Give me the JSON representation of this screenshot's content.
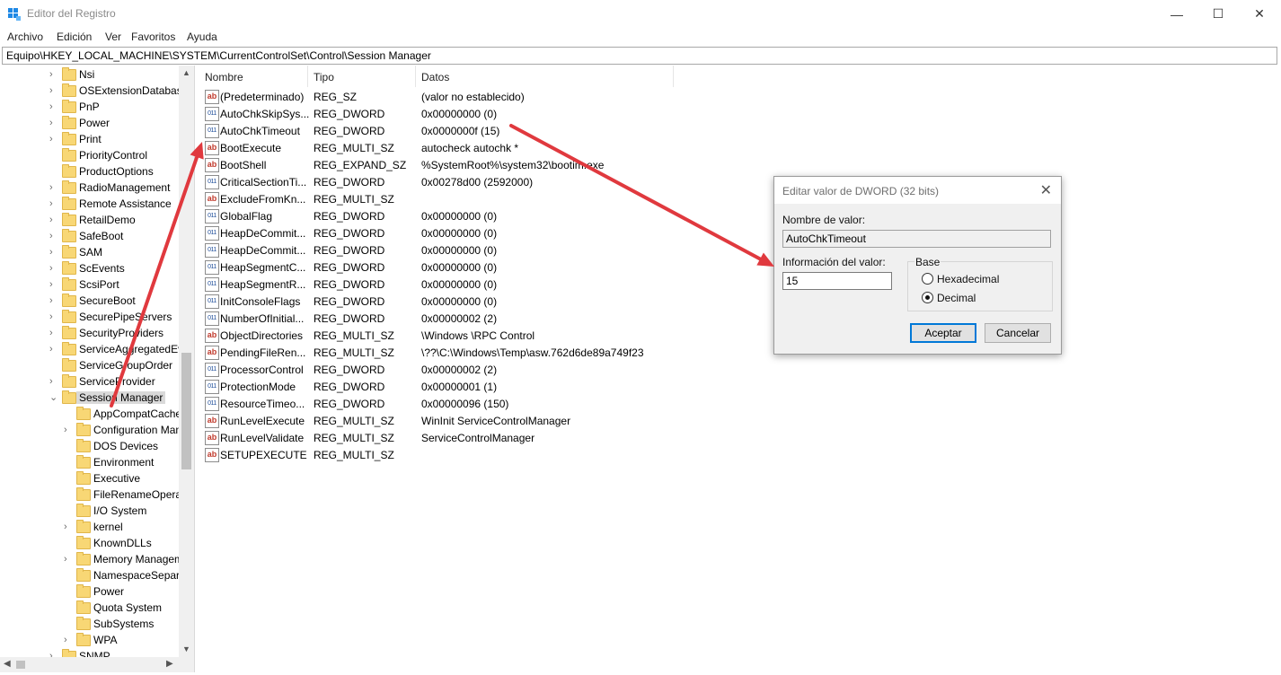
{
  "window": {
    "title": "Editor del Registro",
    "controls": {
      "minimize": "—",
      "maximize": "☐",
      "close": "✕"
    }
  },
  "menu": [
    "Archivo",
    "Edición",
    "Ver",
    "Favoritos",
    "Ayuda"
  ],
  "address": "Equipo\\HKEY_LOCAL_MACHINE\\SYSTEM\\CurrentControlSet\\Control\\Session Manager",
  "tree": {
    "items": [
      {
        "label": "Nsi",
        "level": 1,
        "expand": "collapsed"
      },
      {
        "label": "OSExtensionDatabase",
        "level": 1,
        "expand": "collapsed"
      },
      {
        "label": "PnP",
        "level": 1,
        "expand": "collapsed"
      },
      {
        "label": "Power",
        "level": 1,
        "expand": "collapsed"
      },
      {
        "label": "Print",
        "level": 1,
        "expand": "collapsed"
      },
      {
        "label": "PriorityControl",
        "level": 1,
        "expand": "none"
      },
      {
        "label": "ProductOptions",
        "level": 1,
        "expand": "none"
      },
      {
        "label": "RadioManagement",
        "level": 1,
        "expand": "collapsed"
      },
      {
        "label": "Remote Assistance",
        "level": 1,
        "expand": "collapsed"
      },
      {
        "label": "RetailDemo",
        "level": 1,
        "expand": "collapsed"
      },
      {
        "label": "SafeBoot",
        "level": 1,
        "expand": "collapsed"
      },
      {
        "label": "SAM",
        "level": 1,
        "expand": "collapsed"
      },
      {
        "label": "ScEvents",
        "level": 1,
        "expand": "collapsed"
      },
      {
        "label": "ScsiPort",
        "level": 1,
        "expand": "collapsed"
      },
      {
        "label": "SecureBoot",
        "level": 1,
        "expand": "collapsed"
      },
      {
        "label": "SecurePipeServers",
        "level": 1,
        "expand": "collapsed"
      },
      {
        "label": "SecurityProviders",
        "level": 1,
        "expand": "collapsed"
      },
      {
        "label": "ServiceAggregatedEvents",
        "level": 1,
        "expand": "collapsed"
      },
      {
        "label": "ServiceGroupOrder",
        "level": 1,
        "expand": "none"
      },
      {
        "label": "ServiceProvider",
        "level": 1,
        "expand": "collapsed"
      },
      {
        "label": "Session Manager",
        "level": 1,
        "expand": "expanded",
        "selected": true
      },
      {
        "label": "AppCompatCache",
        "level": 2,
        "expand": "none"
      },
      {
        "label": "Configuration Manager",
        "level": 2,
        "expand": "collapsed"
      },
      {
        "label": "DOS Devices",
        "level": 2,
        "expand": "none"
      },
      {
        "label": "Environment",
        "level": 2,
        "expand": "none"
      },
      {
        "label": "Executive",
        "level": 2,
        "expand": "none"
      },
      {
        "label": "FileRenameOperations",
        "level": 2,
        "expand": "none"
      },
      {
        "label": "I/O System",
        "level": 2,
        "expand": "none"
      },
      {
        "label": "kernel",
        "level": 2,
        "expand": "collapsed"
      },
      {
        "label": "KnownDLLs",
        "level": 2,
        "expand": "none"
      },
      {
        "label": "Memory Management",
        "level": 2,
        "expand": "collapsed"
      },
      {
        "label": "NamespaceSeparation",
        "level": 2,
        "expand": "none"
      },
      {
        "label": "Power",
        "level": 2,
        "expand": "none"
      },
      {
        "label": "Quota System",
        "level": 2,
        "expand": "none"
      },
      {
        "label": "SubSystems",
        "level": 2,
        "expand": "none"
      },
      {
        "label": "WPA",
        "level": 2,
        "expand": "collapsed"
      },
      {
        "label": "SNMP",
        "level": 1,
        "expand": "collapsed"
      }
    ]
  },
  "list": {
    "columns": [
      "Nombre",
      "Tipo",
      "Datos"
    ],
    "rows": [
      {
        "icon": "sz",
        "name": "(Predeterminado)",
        "type": "REG_SZ",
        "data": "(valor no establecido)"
      },
      {
        "icon": "bin",
        "name": "AutoChkSkipSys...",
        "type": "REG_DWORD",
        "data": "0x00000000 (0)"
      },
      {
        "icon": "bin",
        "name": "AutoChkTimeout",
        "type": "REG_DWORD",
        "data": "0x0000000f (15)"
      },
      {
        "icon": "sz",
        "name": "BootExecute",
        "type": "REG_MULTI_SZ",
        "data": "autocheck autochk *"
      },
      {
        "icon": "sz",
        "name": "BootShell",
        "type": "REG_EXPAND_SZ",
        "data": "%SystemRoot%\\system32\\bootim.exe"
      },
      {
        "icon": "bin",
        "name": "CriticalSectionTi...",
        "type": "REG_DWORD",
        "data": "0x00278d00 (2592000)"
      },
      {
        "icon": "sz",
        "name": "ExcludeFromKn...",
        "type": "REG_MULTI_SZ",
        "data": ""
      },
      {
        "icon": "bin",
        "name": "GlobalFlag",
        "type": "REG_DWORD",
        "data": "0x00000000 (0)"
      },
      {
        "icon": "bin",
        "name": "HeapDeCommit...",
        "type": "REG_DWORD",
        "data": "0x00000000 (0)"
      },
      {
        "icon": "bin",
        "name": "HeapDeCommit...",
        "type": "REG_DWORD",
        "data": "0x00000000 (0)"
      },
      {
        "icon": "bin",
        "name": "HeapSegmentC...",
        "type": "REG_DWORD",
        "data": "0x00000000 (0)"
      },
      {
        "icon": "bin",
        "name": "HeapSegmentR...",
        "type": "REG_DWORD",
        "data": "0x00000000 (0)"
      },
      {
        "icon": "bin",
        "name": "InitConsoleFlags",
        "type": "REG_DWORD",
        "data": "0x00000000 (0)"
      },
      {
        "icon": "bin",
        "name": "NumberOfInitial...",
        "type": "REG_DWORD",
        "data": "0x00000002 (2)"
      },
      {
        "icon": "sz",
        "name": "ObjectDirectories",
        "type": "REG_MULTI_SZ",
        "data": "\\Windows \\RPC Control"
      },
      {
        "icon": "sz",
        "name": "PendingFileRen...",
        "type": "REG_MULTI_SZ",
        "data": "\\??\\C:\\Windows\\Temp\\asw.762d6de89a749f23"
      },
      {
        "icon": "bin",
        "name": "ProcessorControl",
        "type": "REG_DWORD",
        "data": "0x00000002 (2)"
      },
      {
        "icon": "bin",
        "name": "ProtectionMode",
        "type": "REG_DWORD",
        "data": "0x00000001 (1)"
      },
      {
        "icon": "bin",
        "name": "ResourceTimeo...",
        "type": "REG_DWORD",
        "data": "0x00000096 (150)"
      },
      {
        "icon": "sz",
        "name": "RunLevelExecute",
        "type": "REG_MULTI_SZ",
        "data": "WinInit ServiceControlManager"
      },
      {
        "icon": "sz",
        "name": "RunLevelValidate",
        "type": "REG_MULTI_SZ",
        "data": "ServiceControlManager"
      },
      {
        "icon": "sz",
        "name": "SETUPEXECUTE",
        "type": "REG_MULTI_SZ",
        "data": ""
      }
    ]
  },
  "dialog": {
    "title": "Editar valor de DWORD (32 bits)",
    "name_label": "Nombre de valor:",
    "name_value": "AutoChkTimeout",
    "data_label": "Información del valor:",
    "data_value": "15",
    "base_label": "Base",
    "radio_hex": "Hexadecimal",
    "radio_dec": "Decimal",
    "selected_base": "Decimal",
    "ok": "Aceptar",
    "cancel": "Cancelar"
  },
  "annotation_color": "#e0393e"
}
